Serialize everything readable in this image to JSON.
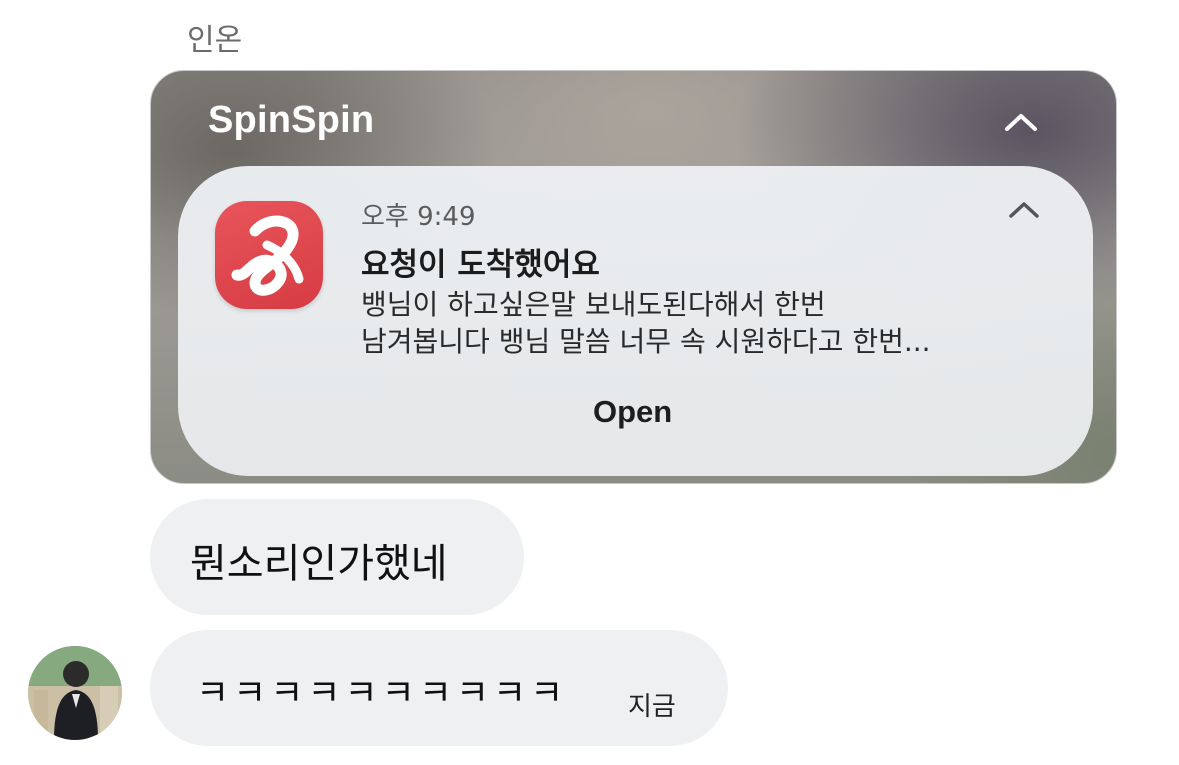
{
  "chat": {
    "sender_name": "인온"
  },
  "notification": {
    "app_name": "SpinSpin",
    "time": "오후 9:49",
    "title": "요청이 도착했어요",
    "body_line1": "뱅님이 하고싶은말 보내도된다해서 한번",
    "body_line2": "남겨봅니다 뱅님 말씀 너무 속 시원하다고 한번...",
    "open_label": "Open",
    "icon": "spinspin-app-icon",
    "accent_color": "#e04a51"
  },
  "messages": [
    {
      "text": "뭔소리인가했네"
    },
    {
      "text": "ㅋㅋㅋㅋㅋㅋㅋㅋㅋㅋ",
      "timestamp": "지금"
    }
  ],
  "colors": {
    "bubble_bg": "#eef0f2",
    "sender_name": "#6b6b6b"
  }
}
